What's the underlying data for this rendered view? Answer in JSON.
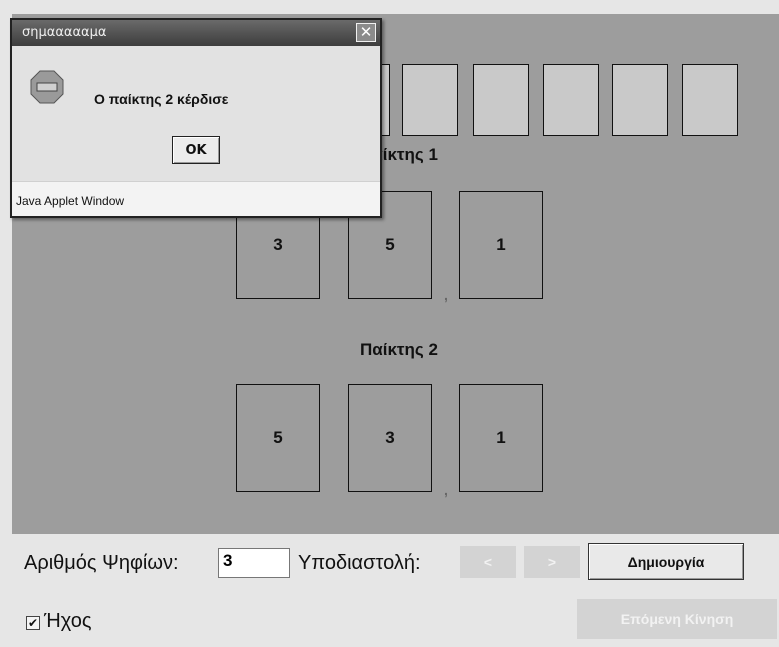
{
  "game": {
    "player1_label": "Παίκτης 1",
    "player2_label": "Παίκτης 2",
    "player1_cards": [
      "3",
      "5",
      "1"
    ],
    "player2_cards": [
      "5",
      "3",
      "1"
    ],
    "decimal_mark": ","
  },
  "controls": {
    "digits_label": "Αριθμός Ψηφίων:",
    "digits_value": "3",
    "decimal_label": "Υποδιαστολή:",
    "left_arrow": "<",
    "right_arrow": ">",
    "create_label": "Δημιουργία",
    "sound_label": "Ήχος",
    "sound_checked": true,
    "next_move_label": "Επόμενη Κίνηση"
  },
  "dialog": {
    "title": "σημαααααμα",
    "close_glyph": "✕",
    "message": "Ο παίκτης 2 κέρδισε",
    "ok_label": "OK",
    "footer": "Java Applet Window",
    "icon": "stop-sign-icon"
  },
  "colors": {
    "applet_background": "#9d9d9d",
    "panel_background": "#e6e6e6",
    "slot": "#c9c9c9"
  }
}
